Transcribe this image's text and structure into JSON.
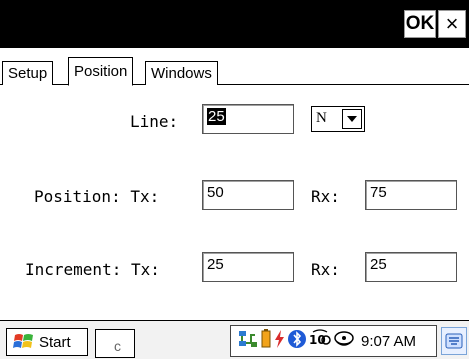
{
  "titlebar": {
    "ok_label": "OK",
    "close_label": "×"
  },
  "tabs": [
    {
      "label": "Setup",
      "active": false
    },
    {
      "label": "Position",
      "active": true
    },
    {
      "label": "Windows",
      "active": false
    }
  ],
  "form": {
    "line_label": "Line:",
    "line_value": "25",
    "line_direction": "N",
    "position_label": "Position: Tx:",
    "position_tx": "50",
    "position_rx_label": "Rx:",
    "position_rx": "75",
    "increment_label": "Increment: Tx:",
    "increment_tx": "25",
    "increment_rx_label": "Rx:",
    "increment_rx": "25"
  },
  "taskbar": {
    "start_label": "Start",
    "window_button_label": "c",
    "clock": "9:07 AM",
    "tray_icons": [
      "network-icon",
      "battery-icon",
      "bluetooth-icon",
      "wifi-icon",
      "volume-icon"
    ],
    "keyboard_icon": "keyboard-icon"
  },
  "colors": {
    "titlebar": "#000000",
    "start_flag_red": "#e23b25",
    "start_flag_green": "#3bb33b",
    "start_flag_blue": "#2a6fd8",
    "start_flag_yellow": "#f2c21b"
  }
}
